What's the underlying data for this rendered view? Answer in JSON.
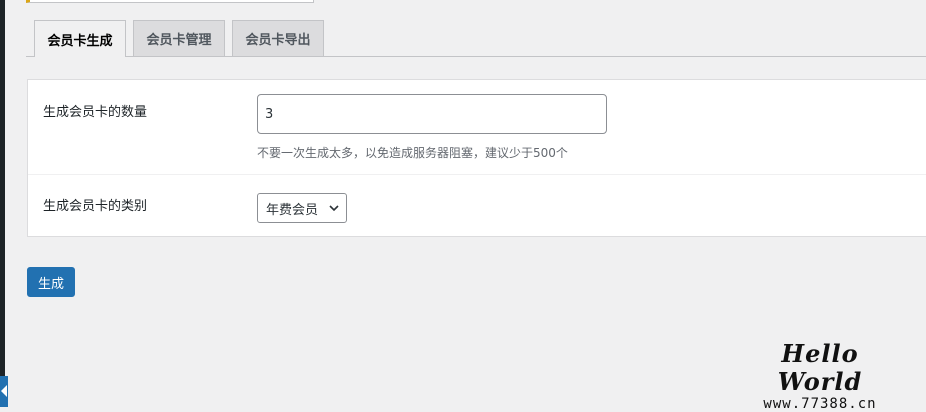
{
  "tabs": [
    {
      "label": "会员卡生成",
      "active": true
    },
    {
      "label": "会员卡管理",
      "active": false
    },
    {
      "label": "会员卡导出",
      "active": false
    }
  ],
  "form": {
    "quantity": {
      "label": "生成会员卡的数量",
      "value": "3",
      "hint": "不要一次生成太多，以免造成服务器阻塞，建议少于500个"
    },
    "type": {
      "label": "生成会员卡的类别",
      "selected": "年费会员"
    }
  },
  "submit_label": "生成",
  "watermark": {
    "title": "Hello World",
    "url": "www.77388.cn"
  },
  "colors": {
    "primary": "#2271b1",
    "background": "#f0f0f1",
    "notice_accent": "#dba617"
  }
}
